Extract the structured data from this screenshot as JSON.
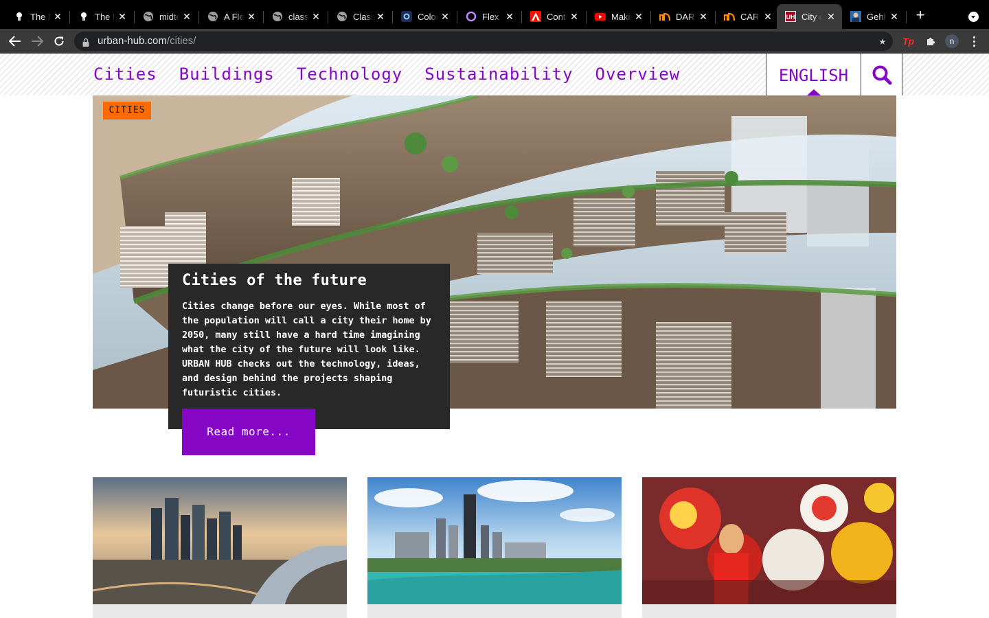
{
  "browser": {
    "tabs": [
      {
        "title": "The N",
        "icon": "bulb-icon"
      },
      {
        "title": "The N",
        "icon": "bulb-icon"
      },
      {
        "title": "midte",
        "icon": "globe-icon"
      },
      {
        "title": "A Fle",
        "icon": "globe-icon"
      },
      {
        "title": "class",
        "icon": "globe-icon"
      },
      {
        "title": "Class",
        "icon": "globe-icon"
      },
      {
        "title": "Color",
        "icon": "color-picker-icon"
      },
      {
        "title": "Flex C",
        "icon": "ring-icon"
      },
      {
        "title": "Conti",
        "icon": "adobe-icon"
      },
      {
        "title": "Makin",
        "icon": "youtube-icon"
      },
      {
        "title": "DART",
        "icon": "dart-logo-icon"
      },
      {
        "title": "CART",
        "icon": "dart-logo-icon"
      },
      {
        "title": "City o",
        "icon": "uh-logo-icon",
        "active": true
      },
      {
        "title": "Gehl",
        "icon": "profile-photo-icon"
      }
    ],
    "url_host": "urban-hub.com",
    "url_path": "/cities/",
    "extension_label": "Tp",
    "profile_initial": "n"
  },
  "site": {
    "nav": [
      "Cities",
      "Buildings",
      "Technology",
      "Sustainability",
      "Overview"
    ],
    "language": "ENGLISH",
    "accent_color": "#8507c5"
  },
  "hero": {
    "badge": "CITIES",
    "badge_color": "#ff6b00",
    "title": "Cities of the future",
    "body": "Cities change before our eyes. While most of the population will call a city their home by 2050, many still have a hard time imagining what the city of the future will look like. URBAN HUB checks out the technology, ideas, and design behind the projects shaping futuristic cities.",
    "cta": "Read more..."
  }
}
